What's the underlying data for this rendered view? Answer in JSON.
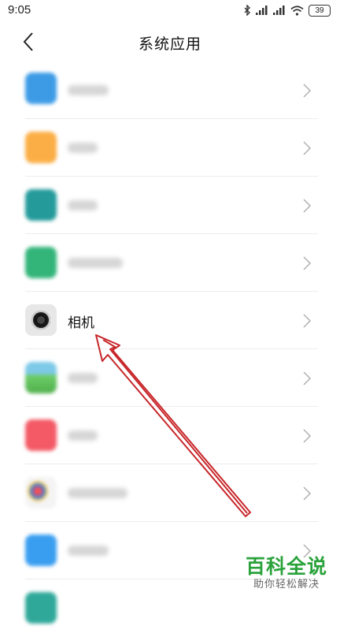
{
  "status_bar": {
    "time": "9:05",
    "battery": "39",
    "icons": [
      "bluetooth-icon",
      "signal-icon",
      "signal-icon",
      "wifi-icon",
      "battery-icon"
    ]
  },
  "header": {
    "title": "系统应用",
    "back_icon": "chevron-left-icon"
  },
  "colors": {
    "icon_blue": "#3d9be6",
    "icon_orange": "#fbae45",
    "icon_teal": "#249a9b",
    "icon_green": "#33b57a",
    "icon_camera": "#e7e7e7",
    "icon_gallery": "#6fcf6b",
    "icon_music": "#f35a66",
    "icon_browser": "#3a9ef0",
    "arrow_red": "#c8262a",
    "watermark_green": "#2aa23a"
  },
  "list": {
    "items": [
      {
        "label": "",
        "blurred": true
      },
      {
        "label": "",
        "blurred": true
      },
      {
        "label": "",
        "blurred": true
      },
      {
        "label": "",
        "blurred": true
      },
      {
        "label": "相机",
        "blurred": false,
        "icon": "camera-icon"
      },
      {
        "label": "",
        "blurred": true
      },
      {
        "label": "",
        "blurred": true
      },
      {
        "label": "",
        "blurred": true
      },
      {
        "label": "",
        "blurred": true
      }
    ]
  },
  "watermark": {
    "title": "百科全说",
    "subtitle": "助你轻松解决"
  }
}
